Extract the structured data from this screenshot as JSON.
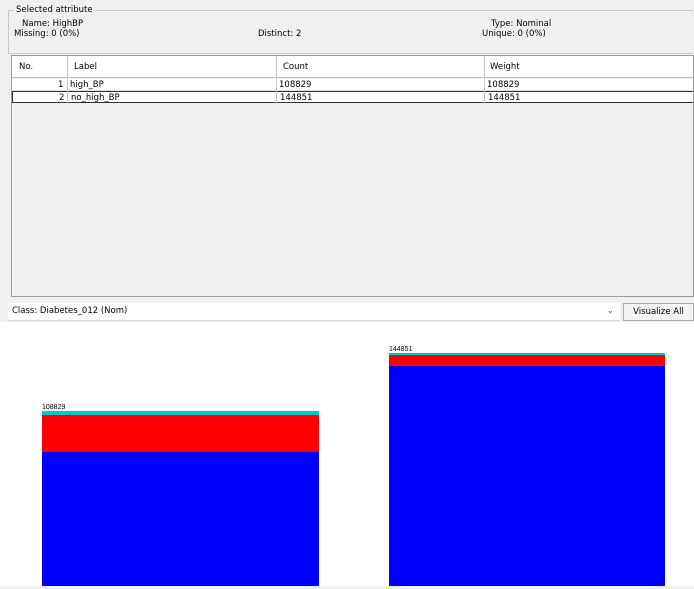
{
  "attribute": {
    "legend": "Selected attribute",
    "name_text": "Name: HighBP",
    "missing_text": "Missing: 0 (0%)",
    "distinct_text": "Distinct: 2",
    "type_text": "Type: Nominal",
    "unique_text": "Unique: 0 (0%)"
  },
  "table": {
    "headers": [
      "No.",
      "Label",
      "Count",
      "Weight"
    ],
    "rows": [
      {
        "no": "1",
        "label": "high_BP",
        "count": "108829",
        "weight": "108829"
      },
      {
        "no": "2",
        "label": "no_high_BP",
        "count": "144851",
        "weight": "144851"
      }
    ]
  },
  "class_selector": {
    "value": "Class: Diabetes_012 (Nom)",
    "chevron_icon": "chevron-down-icon"
  },
  "visualize_button": "Visualize All",
  "chart_data": {
    "type": "bar",
    "stacked": true,
    "categories": [
      "high_BP",
      "no_high_BP"
    ],
    "data_labels": [
      "108829",
      "144851"
    ],
    "totals": [
      108829,
      144851
    ],
    "series": [
      {
        "color": "#0000ff",
        "values": [
          83300,
          137000
        ]
      },
      {
        "color": "#ff0000",
        "values": [
          23000,
          6600
        ]
      },
      {
        "color": "#00c8c8",
        "values": [
          2529,
          1251
        ]
      }
    ],
    "ylim": [
      0,
      144851
    ]
  }
}
